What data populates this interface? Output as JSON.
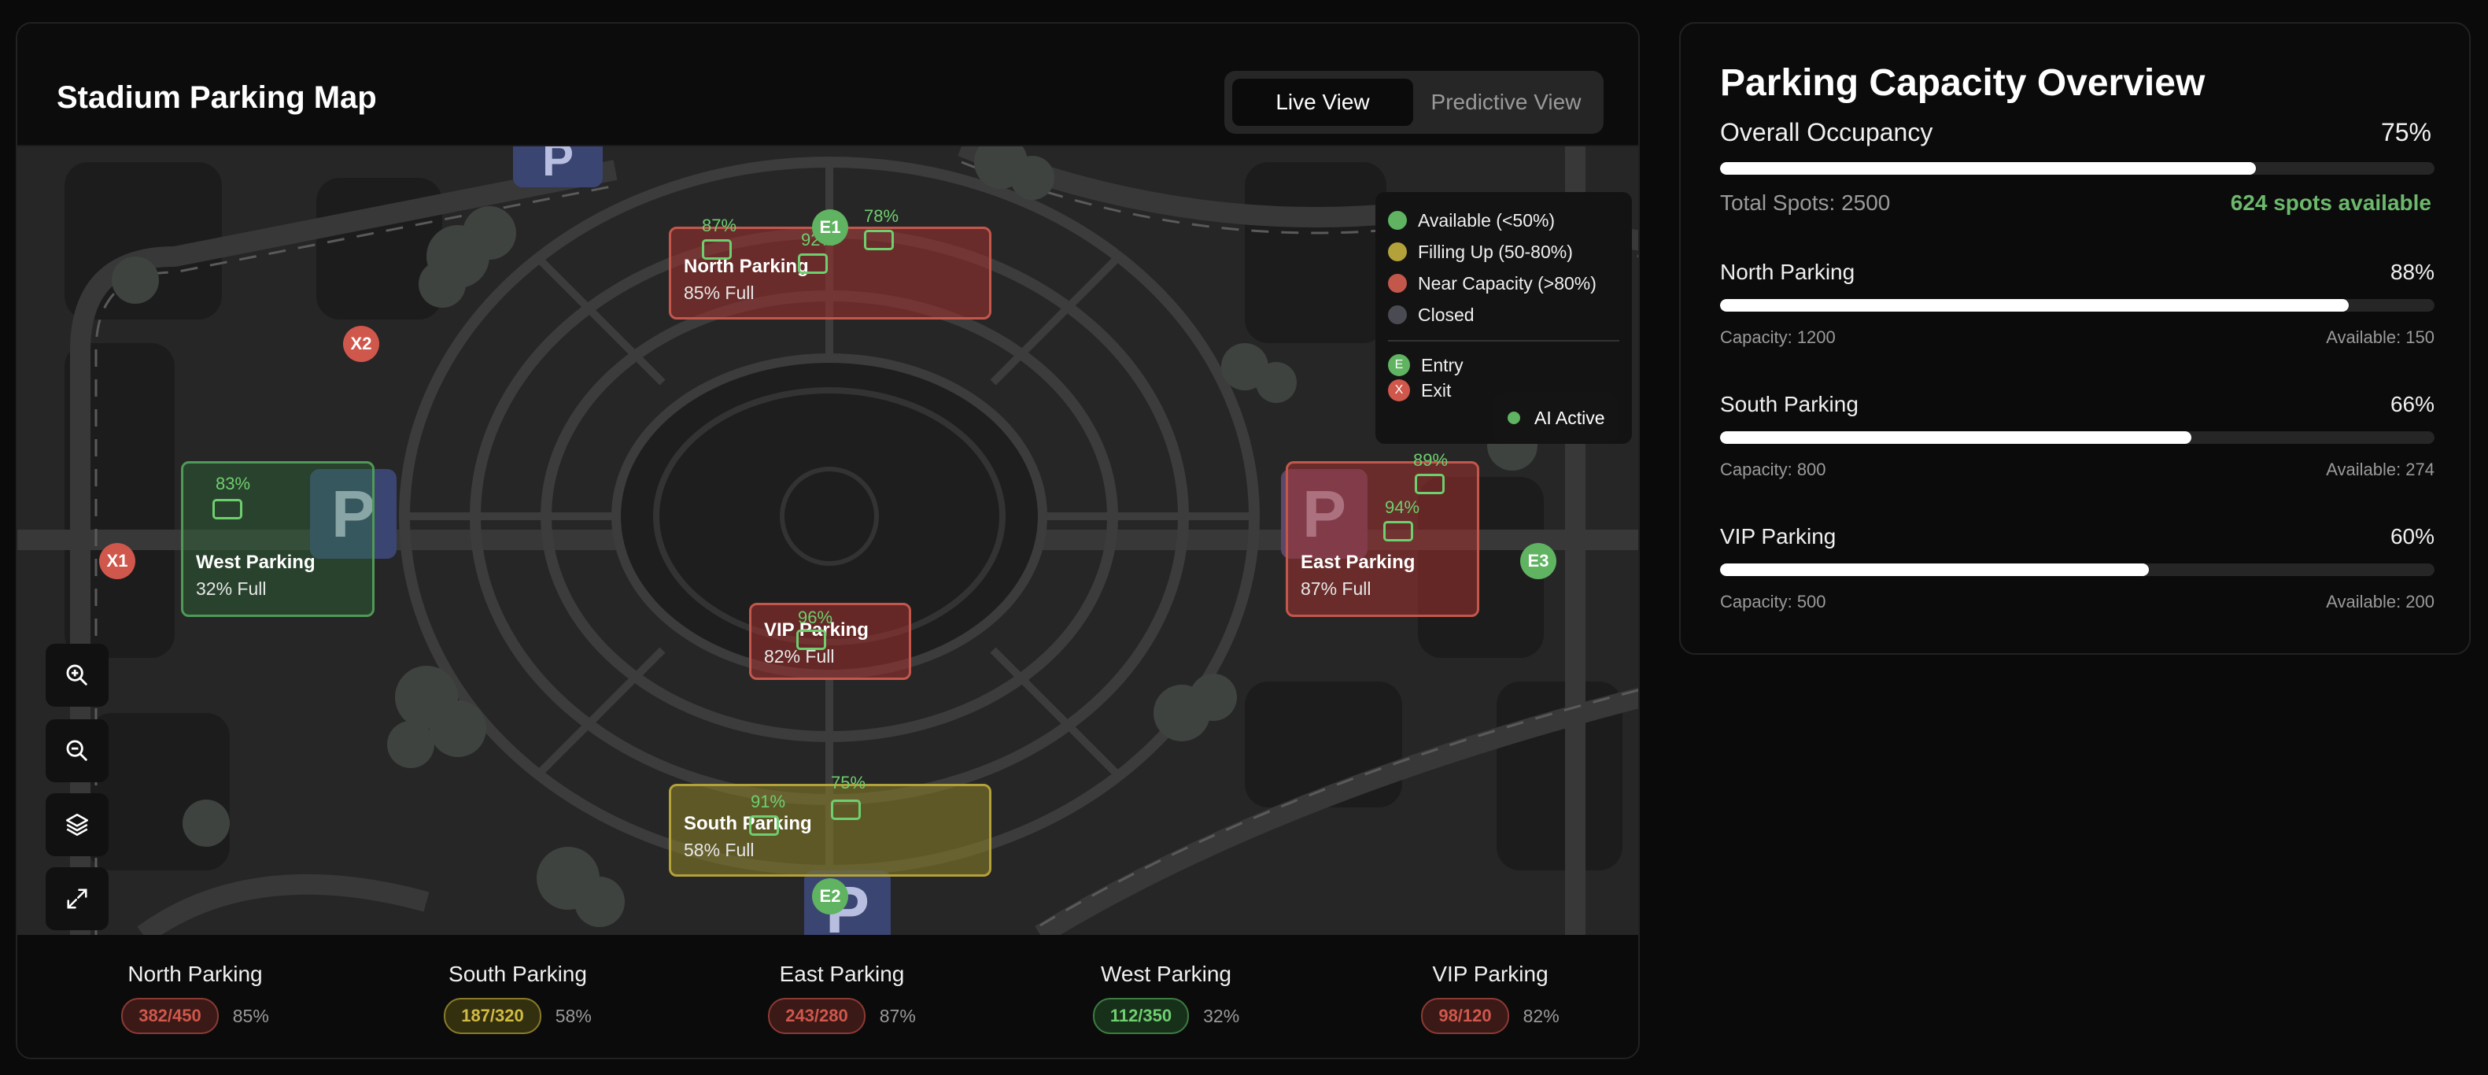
{
  "map": {
    "title": "Stadium Parking Map",
    "view_toggle": {
      "live": "Live View",
      "predictive": "Predictive View"
    },
    "zones": {
      "north": {
        "name": "North Parking",
        "full": "85% Full",
        "spots": [
          "87%",
          "92%",
          "78%"
        ]
      },
      "west": {
        "name": "West Parking",
        "full": "32% Full",
        "spots": [
          "83%"
        ]
      },
      "east": {
        "name": "East Parking",
        "full": "87% Full",
        "spots": [
          "89%",
          "94%"
        ]
      },
      "vip": {
        "name": "VIP Parking",
        "full": "82% Full",
        "spots": [
          "96%"
        ]
      },
      "south": {
        "name": "South Parking",
        "full": "58% Full",
        "spots": [
          "91%",
          "75%"
        ]
      }
    },
    "parking_symbol": "P",
    "markers": {
      "e1": "E1",
      "e2": "E2",
      "e3": "E3",
      "x1": "X1",
      "x2": "X2"
    },
    "legend": {
      "available": "Available (<50%)",
      "filling": "Filling Up (50-80%)",
      "near": "Near Capacity (>80%)",
      "closed": "Closed",
      "entry_symbol": "E",
      "entry": "Entry",
      "exit_symbol": "X",
      "exit": "Exit",
      "colors": {
        "available": "#5fb361",
        "filling": "#b3a13a",
        "near": "#c4574c",
        "closed": "#4a4a52"
      }
    },
    "ai_status": "AI Active",
    "controls": [
      "zoom-in-icon",
      "zoom-out-icon",
      "layers-icon",
      "fullscreen-icon"
    ]
  },
  "summary": [
    {
      "name": "North Parking",
      "count": "382/450",
      "pct": "85%",
      "status": "red"
    },
    {
      "name": "South Parking",
      "count": "187/320",
      "pct": "58%",
      "status": "yellow"
    },
    {
      "name": "East Parking",
      "count": "243/280",
      "pct": "87%",
      "status": "red"
    },
    {
      "name": "West Parking",
      "count": "112/350",
      "pct": "32%",
      "status": "green"
    },
    {
      "name": "VIP Parking",
      "count": "98/120",
      "pct": "82%",
      "status": "red"
    }
  ],
  "capacity": {
    "title": "Parking Capacity Overview",
    "overall_label": "Overall Occupancy",
    "overall_pct": "75%",
    "overall_fill": 0.75,
    "total": "Total Spots: 2500",
    "available": "624 spots available",
    "lots": [
      {
        "name": "North Parking",
        "pct": "88%",
        "fill": 0.88,
        "capacity": "Capacity: 1200",
        "available": "Available: 150"
      },
      {
        "name": "South Parking",
        "pct": "66%",
        "fill": 0.66,
        "capacity": "Capacity: 800",
        "available": "Available: 274"
      },
      {
        "name": "VIP Parking",
        "pct": "60%",
        "fill": 0.6,
        "capacity": "Capacity: 500",
        "available": "Available: 200"
      }
    ]
  }
}
